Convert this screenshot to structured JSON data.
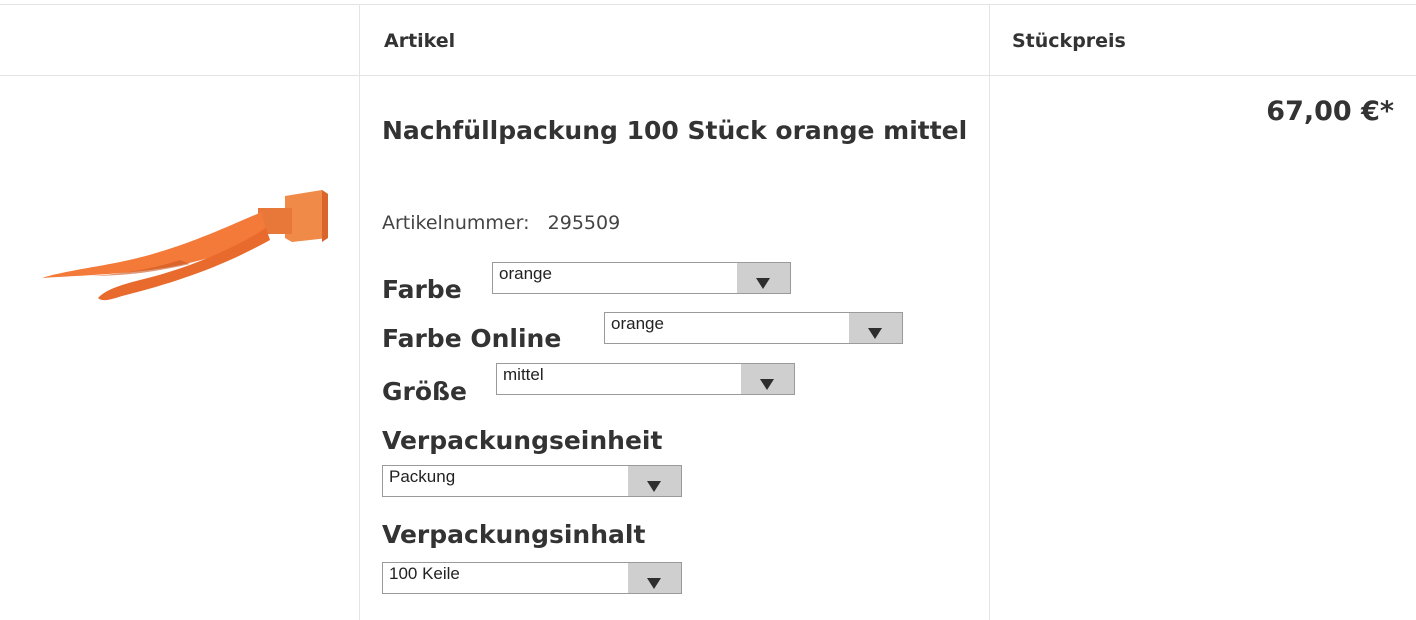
{
  "table": {
    "headers": {
      "image": "",
      "article": "Artikel",
      "unit_price": "Stückpreis"
    }
  },
  "product": {
    "title": "Nachfüllpackung 100 Stück orange mittel",
    "article_number_label": "Artikelnummer:",
    "article_number": "295509",
    "image_icon": "orange-wedge-image",
    "image_color": "#f47a3a",
    "options": {
      "farbe": {
        "label": "Farbe",
        "value": "orange"
      },
      "farbe_online": {
        "label": "Farbe Online",
        "value": "orange"
      },
      "groesse": {
        "label": "Größe",
        "value": "mittel"
      },
      "verpackungseinheit": {
        "label": "Verpackungseinheit",
        "value": "Packung"
      },
      "verpackungsinhalt": {
        "label": "Verpackungsinhalt",
        "value": "100 Keile"
      }
    },
    "price": "67,00 €*"
  }
}
